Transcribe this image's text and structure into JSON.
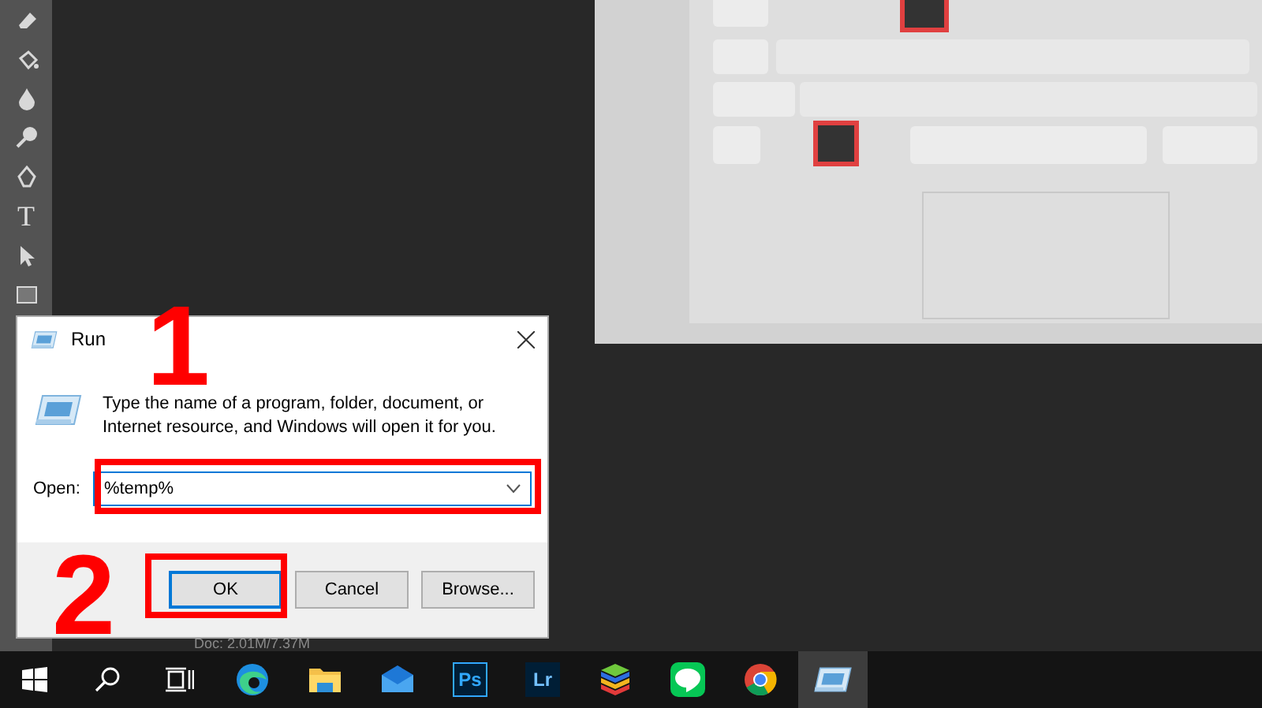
{
  "toolbar": {
    "type_tool": "T"
  },
  "status_bar": {
    "doc_size": "Doc: 2.01M/7.37M"
  },
  "dialog": {
    "title": "Run",
    "message": "Type the name of a program, folder, document, or Internet resource, and Windows will open it for you.",
    "open_label": "Open:",
    "open_value": "%temp%",
    "buttons": [
      {
        "label": "OK",
        "default": true
      },
      {
        "label": "Cancel",
        "default": false
      },
      {
        "label": "Browse...",
        "default": false
      }
    ]
  },
  "annotations": [
    {
      "label": "1"
    },
    {
      "label": "2"
    }
  ],
  "taskbar": {
    "items": [
      {
        "kind": "start",
        "selected": false
      },
      {
        "kind": "search",
        "selected": false
      },
      {
        "kind": "taskview",
        "selected": false
      },
      {
        "kind": "edge",
        "selected": false
      },
      {
        "kind": "explorer",
        "selected": false
      },
      {
        "kind": "mail",
        "selected": false
      },
      {
        "kind": "photoshop",
        "label": "Ps",
        "selected": false
      },
      {
        "kind": "lightroom",
        "label": "Lr",
        "selected": false
      },
      {
        "kind": "layers",
        "selected": false
      },
      {
        "kind": "chat",
        "selected": false
      },
      {
        "kind": "chrome",
        "selected": false
      },
      {
        "kind": "run",
        "selected": true
      }
    ]
  }
}
